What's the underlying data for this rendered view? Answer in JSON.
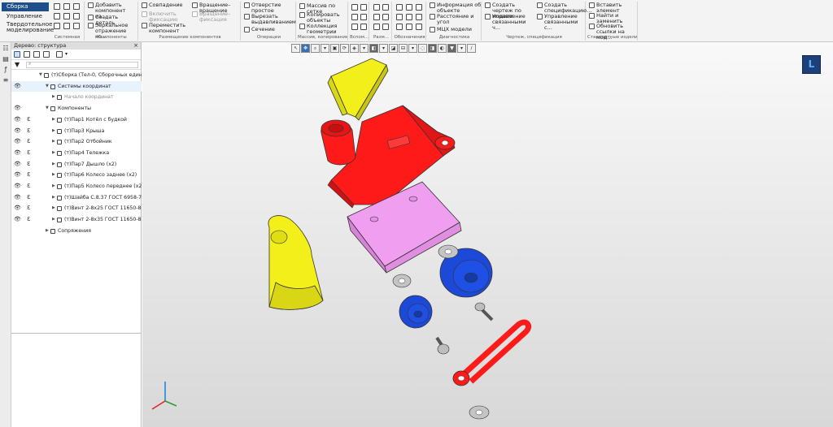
{
  "ribbon": {
    "modes": [
      "Сборка",
      "Управление",
      "Твердотельное моделирование"
    ],
    "groups": {
      "system": {
        "title": "Системная"
      },
      "components": {
        "title": "Компоненты",
        "items": [
          "Добавить компонент из...",
          "Создать деталь",
          "Зеркальное отражение ко..."
        ]
      },
      "placement": {
        "title": "Размещение компонентов",
        "items": [
          "Совпадение",
          "Вращение–вращение",
          "Включить фиксацию",
          "Вращение–фиксация",
          "Переместить компонент"
        ]
      },
      "operations": {
        "title": "Операции",
        "items": [
          "Отверстие простое",
          "Вырезать выдавливанием",
          "Сечение"
        ]
      },
      "array": {
        "title": "Массив, копирование",
        "items": [
          "Массив по сетке",
          "Копировать объекты",
          "Коллекция геометрии"
        ]
      },
      "aux": {
        "title": "Вспом..."
      },
      "sizes": {
        "title": "Разм..."
      },
      "notation": {
        "title": "Обозначения"
      },
      "diagnostics": {
        "title": "Диагностика",
        "items": [
          "Информация об объекте",
          "Расстояние и угол",
          "МЦХ модели"
        ]
      },
      "drawings": {
        "title": "Чертеж, спецификация",
        "items": [
          "Создать чертеж по модели",
          "Управление связанными ч...",
          "Создать спецификацию...",
          "Управление связанными с..."
        ]
      },
      "standard": {
        "title": "Стандартные изделия",
        "items": [
          "Вставить элемент",
          "Найти и заменить",
          "Обновить ссылки на мод..."
        ]
      }
    }
  },
  "tree": {
    "header": "Дерево: структура",
    "close": "×",
    "rows": [
      {
        "label": "(т)Сборка (Тел-0, Сборочных единиц...",
        "indent": 0,
        "eye": false
      },
      {
        "label": "Системы координат",
        "indent": 1,
        "eye": true
      },
      {
        "label": "Начало координат",
        "indent": 2,
        "eye": false
      },
      {
        "label": "Компоненты",
        "indent": 1,
        "eye": true
      },
      {
        "label": "(т)Пар1 Котёл с будкой",
        "indent": 2,
        "eye": true
      },
      {
        "label": "(т)Пар3 Крыша",
        "indent": 2,
        "eye": true
      },
      {
        "label": "(т)Пар2 Отбойник",
        "indent": 2,
        "eye": true
      },
      {
        "label": "(т)Пар4 Тележка",
        "indent": 2,
        "eye": true
      },
      {
        "label": "(т)Пар7 Дышло (x2)",
        "indent": 2,
        "eye": true
      },
      {
        "label": "(т)Пар6 Колесо заднее (x2)",
        "indent": 2,
        "eye": true
      },
      {
        "label": "(т)Пар5 Колесо переднее (x2)",
        "indent": 2,
        "eye": true
      },
      {
        "label": "(т)Шайба С.8.37 ГОСТ 6958-78 (x6)",
        "indent": 2,
        "eye": true
      },
      {
        "label": "(т)Винт 2-8x25 ГОСТ 11650-80 (x2)",
        "indent": 2,
        "eye": true
      },
      {
        "label": "(т)Винт 2-8x35 ГОСТ 11650-80 (x2)",
        "indent": 2,
        "eye": true
      },
      {
        "label": "Сопряжения",
        "indent": 1,
        "eye": false
      }
    ]
  },
  "viewport": {
    "parts_colors": {
      "yellow": "#f2ef1a",
      "red": "#ff1a1a",
      "pink": "#f09ef0",
      "blue": "#1c49d8",
      "grey": "#c4c4c4"
    }
  }
}
